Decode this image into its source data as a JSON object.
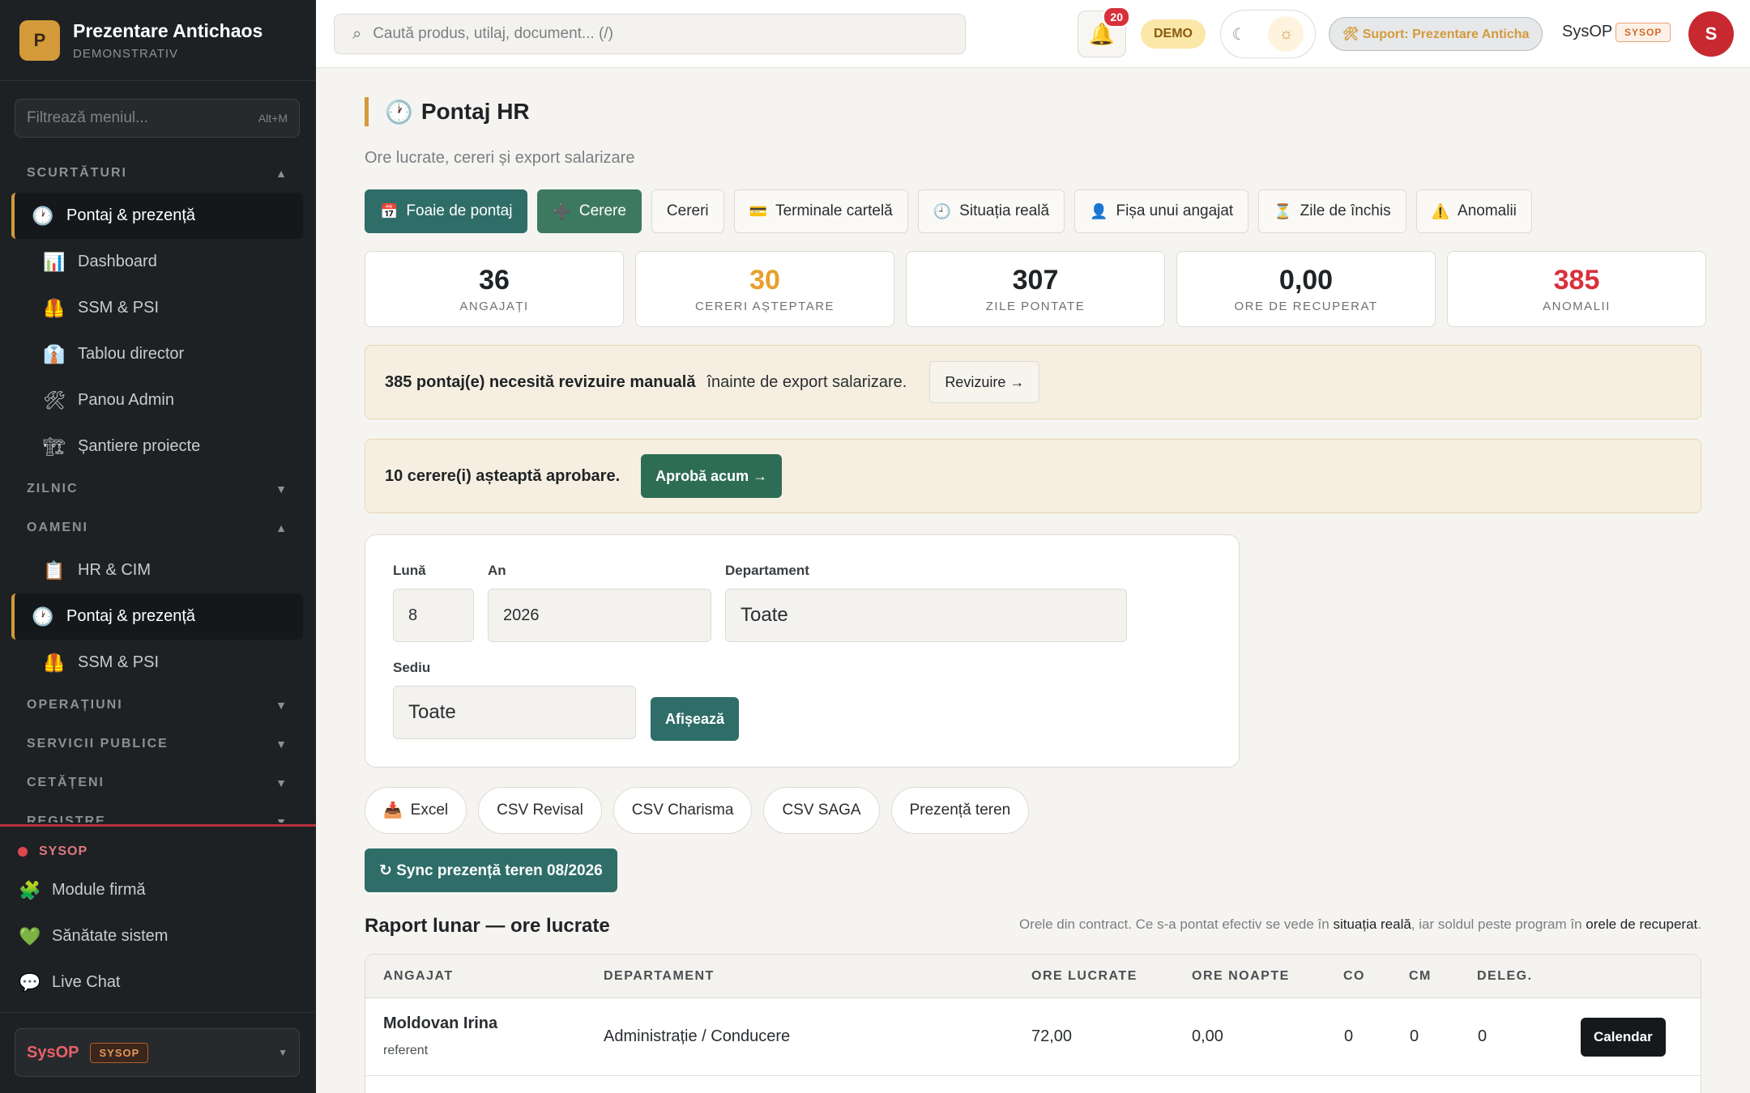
{
  "brand": {
    "logo_letter": "P",
    "name": "Prezentare Antichaos",
    "sub": "DEMONSTRATIV"
  },
  "sidebar": {
    "filter_placeholder": "Filtrează meniul...",
    "filter_kbd": "Alt+M",
    "sections": {
      "shortcuts": "SCURTĂTURI",
      "daily": "ZILNIC",
      "people": "OAMENI",
      "operations": "OPERAȚIUNI",
      "public_services": "SERVICII PUBLICE",
      "citizens": "CETĂȚENI",
      "registers": "REGISTRE"
    },
    "shortcut_items": [
      {
        "label": "Pontaj & prezență",
        "icon": "🕐"
      },
      {
        "label": "Dashboard",
        "icon": "📊"
      },
      {
        "label": "SSM & PSI",
        "icon": "🦺"
      },
      {
        "label": "Tablou director",
        "icon": "👔"
      },
      {
        "label": "Panou Admin",
        "icon": "🛠"
      },
      {
        "label": "Șantiere proiecte",
        "icon": "🏗"
      }
    ],
    "people_items": [
      {
        "label": "HR & CIM",
        "icon": "📋"
      },
      {
        "label": "Pontaj & prezență",
        "icon": "🕐"
      },
      {
        "label": "SSM & PSI",
        "icon": "🦺"
      }
    ],
    "sysop": {
      "tag": "SYSOP",
      "items": [
        {
          "label": "Module firmă",
          "icon": "🧩"
        },
        {
          "label": "Sănătate sistem",
          "icon": "💚"
        },
        {
          "label": "Live Chat",
          "icon": "💬"
        }
      ]
    },
    "user": {
      "name": "SysOP",
      "role": "SYSOP"
    }
  },
  "topbar": {
    "search_placeholder": "Caută produs, utilaj, document... (/)",
    "notifications": "20",
    "demo": "DEMO",
    "support": "🛠 Suport: Prezentare Anticha",
    "user": "SysOP",
    "role": "SYSOP",
    "avatar": "S"
  },
  "page": {
    "title": "Pontaj HR",
    "subtitle": "Ore lucrate, cereri și export salarizare",
    "tabs": [
      {
        "label": "Foaie de pontaj",
        "icon": "📅"
      },
      {
        "label": "Cerere",
        "icon": "➕"
      },
      {
        "label": "Cereri",
        "icon": ""
      },
      {
        "label": "Terminale cartelă",
        "icon": "💳"
      },
      {
        "label": "Situația reală",
        "icon": "🕘"
      },
      {
        "label": "Fișa unui angajat",
        "icon": "👤"
      },
      {
        "label": "Zile de închis",
        "icon": "⏳"
      },
      {
        "label": "Anomalii",
        "icon": "⚠️"
      }
    ],
    "stats": [
      {
        "num": "36",
        "label": "ANGAJAȚI"
      },
      {
        "num": "30",
        "label": "CERERI AȘTEPTARE"
      },
      {
        "num": "307",
        "label": "ZILE PONTATE"
      },
      {
        "num": "0,00",
        "label": "ORE DE RECUPERAT"
      },
      {
        "num": "385",
        "label": "ANOMALII"
      }
    ],
    "alert1": {
      "strong": "385 pontaj(e) necesită revizuire manuală",
      "rest": "înainte de export salarizare.",
      "button": "Revizuire →"
    },
    "alert2": {
      "strong": "10 cerere(i) așteaptă aprobare.",
      "button": "Aprobă acum →"
    },
    "filters": {
      "month_label": "Lună",
      "month_value": "8",
      "year_label": "An",
      "year_value": "2026",
      "dept_label": "Departament",
      "dept_value": "Toate",
      "site_label": "Sediu",
      "site_value": "Toate",
      "show_button": "Afișează"
    },
    "exports": [
      {
        "label": "Excel",
        "icon": "📥"
      },
      {
        "label": "CSV Revisal",
        "icon": ""
      },
      {
        "label": "CSV Charisma",
        "icon": ""
      },
      {
        "label": "CSV SAGA",
        "icon": ""
      },
      {
        "label": "Prezență teren",
        "icon": ""
      }
    ],
    "sync_button": "↻ Sync prezență teren 08/2026",
    "report_title": "Raport lunar — ore lucrate",
    "report_note": {
      "p1": "Orele din contract. Ce s-a pontat efectiv se vede în ",
      "link1": "situația reală",
      "p2": ", iar soldul peste program în ",
      "link2": "orele de recuperat",
      "p3": "."
    },
    "table": {
      "headers": [
        "ANGAJAT",
        "DEPARTAMENT",
        "ORE LUCRATE",
        "ORE NOAPTE",
        "CO",
        "CM",
        "DELEG."
      ],
      "rows": [
        {
          "name": "Moldovan Irina",
          "role": "referent",
          "dept": "Administrație / Conducere",
          "hours": "72,00",
          "night": "0,00",
          "co": "0",
          "cm": "0",
          "deleg": "0",
          "action": "Calendar"
        }
      ]
    }
  }
}
